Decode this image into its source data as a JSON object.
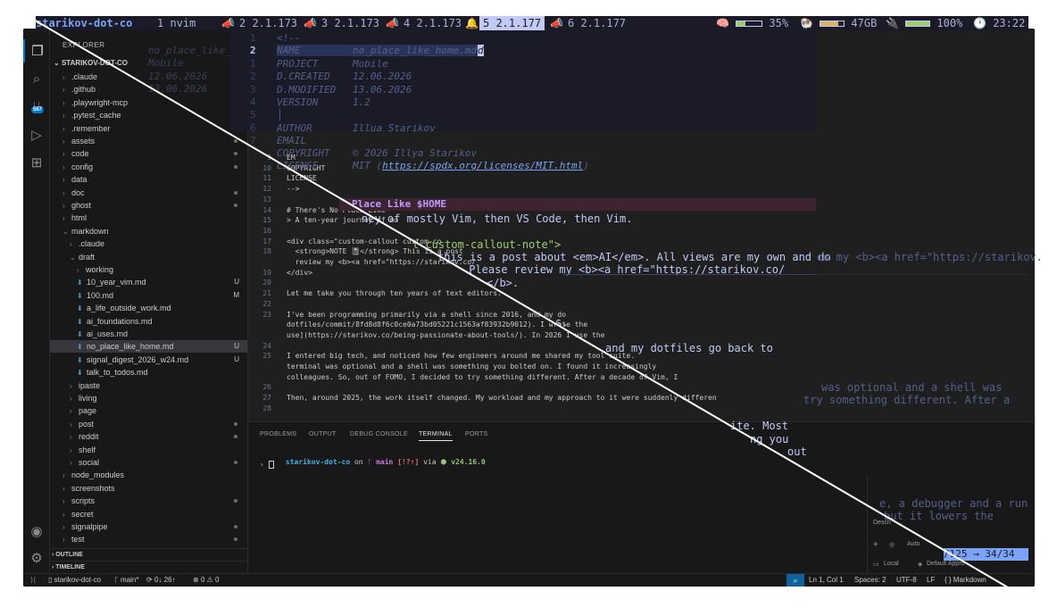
{
  "tmux": {
    "session": "starikov-dot-co",
    "windows": [
      {
        "label": "1 nvim",
        "icon": "",
        "selected": false
      },
      {
        "label": "2 2.1.173",
        "icon": "📣",
        "selected": false
      },
      {
        "label": "3 2.1.173",
        "icon": "📣",
        "selected": false
      },
      {
        "label": "4 2.1.173",
        "icon": "📣",
        "selected": false
      },
      {
        "label": "5 2.1.177",
        "icon": "🔔",
        "selected": true
      },
      {
        "label": "6 2.1.177",
        "icon": "📣",
        "selected": false
      }
    ],
    "cpu": "35%",
    "memory": "47GB",
    "battery": "100%",
    "clock": "23:22",
    "cpu_level": 0.35,
    "memory_level": 0.75,
    "battery_level": 1.0,
    "colors": {
      "session": "#7aa2f7",
      "selected_window": "#c0caf5",
      "battery": "#9ece6a"
    }
  },
  "nvim": {
    "header_lines": [
      {
        "num": "1",
        "label": "<!--",
        "value": ""
      },
      {
        "num": "2",
        "label": "NAME",
        "value": "no_place_like_home.md"
      },
      {
        "num": "1",
        "label": "PROJECT",
        "value": "Mobile"
      },
      {
        "num": "2",
        "label": "D.CREATED",
        "value": "12.06.2026"
      },
      {
        "num": "3",
        "label": "D.MODIFIED",
        "value": "13.06.2026"
      },
      {
        "num": "4",
        "label": "VERSION",
        "value": "1.2"
      },
      {
        "num": "5",
        "label": "",
        "value": ""
      },
      {
        "num": "6",
        "label": "AUTHOR",
        "value": "Illua Starikov"
      },
      {
        "num": "7",
        "label": "EMAIL",
        "value": ""
      }
    ],
    "overlay_lines": [
      {
        "label": "COPYRIGHT",
        "value": "© 2026 Illya Starikov"
      },
      {
        "label": "LICENSE",
        "value": "MIT (https://spdx.org/licenses/MIT.html)"
      }
    ],
    "ghost_left": [
      "no_place_like_",
      "Mobile",
      "12.06.2026",
      "13.06.2026"
    ],
    "heading": "Place Like $HOME",
    "line_ney": "ney of mostly Vim, then VS Code, then Vim.",
    "line_callout": "t custom-callout-note\">",
    "line_post": "this is a post about <em>AI</em>. All views are my own and do",
    "line_review": " Please review my <b><a href=\"https://starikov.co/",
    "line_b": "</b>.",
    "line_right_review": "ew my <b><a href=\"https://starikov.",
    "line_s": "s.",
    "line_dotfiles": "and my dotfiles go back to",
    "line_optional": "was optional and a shell was",
    "line_try": "try something different. After a",
    "line_ite": "ite. Most",
    "line_ng": "ng you",
    "line_out": "out",
    "line_debugger": "e, a debugger and a run",
    "line_lowers": "but it lowers the",
    "status": "/125 → 34/34"
  },
  "vscode": {
    "activity": [
      "files-icon",
      "search-icon",
      "source-control-icon",
      "run-debug-icon",
      "extensions-icon"
    ],
    "scm_badge": "567",
    "explorer_title": "EXPLORER",
    "repo": "STARIKOV-DOT-CO",
    "tree": [
      {
        "label": ".claude",
        "indent": 1,
        "type": "folder",
        "status": ""
      },
      {
        "label": ".github",
        "indent": 1,
        "type": "folder",
        "status": ""
      },
      {
        "label": ".playwright-mcp",
        "indent": 1,
        "type": "folder",
        "status": ""
      },
      {
        "label": ".pytest_cache",
        "indent": 1,
        "type": "folder",
        "status": ""
      },
      {
        "label": ".remember",
        "indent": 1,
        "type": "folder",
        "status": ""
      },
      {
        "label": "assets",
        "indent": 1,
        "type": "folder",
        "status": "dot"
      },
      {
        "label": "code",
        "indent": 1,
        "type": "folder",
        "status": "dot"
      },
      {
        "label": "config",
        "indent": 1,
        "type": "folder",
        "status": "dot"
      },
      {
        "label": "data",
        "indent": 1,
        "type": "folder",
        "status": ""
      },
      {
        "label": "doc",
        "indent": 1,
        "type": "folder",
        "status": "dot"
      },
      {
        "label": "ghost",
        "indent": 1,
        "type": "folder",
        "status": "dot"
      },
      {
        "label": "html",
        "indent": 1,
        "type": "folder",
        "status": ""
      },
      {
        "label": "markdown",
        "indent": 1,
        "type": "folder-open",
        "status": ""
      },
      {
        "label": ".claude",
        "indent": 2,
        "type": "folder",
        "status": ""
      },
      {
        "label": "draft",
        "indent": 2,
        "type": "folder-open",
        "status": ""
      },
      {
        "label": "working",
        "indent": 3,
        "type": "folder",
        "status": ""
      },
      {
        "label": "10_year_vim.md",
        "indent": 3,
        "type": "file",
        "status": "U"
      },
      {
        "label": "100.md",
        "indent": 3,
        "type": "file",
        "status": "M"
      },
      {
        "label": "a_life_outside_work.md",
        "indent": 3,
        "type": "file",
        "status": ""
      },
      {
        "label": "ai_foundations.md",
        "indent": 3,
        "type": "file",
        "status": ""
      },
      {
        "label": "ai_uses.md",
        "indent": 3,
        "type": "file",
        "status": ""
      },
      {
        "label": "no_place_like_home.md",
        "indent": 3,
        "type": "file",
        "status": "U",
        "selected": true
      },
      {
        "label": "signal_digest_2026_w24.md",
        "indent": 3,
        "type": "file",
        "status": "U"
      },
      {
        "label": "talk_to_todos.md",
        "indent": 3,
        "type": "file",
        "status": ""
      },
      {
        "label": "ipaste",
        "indent": 2,
        "type": "folder",
        "status": ""
      },
      {
        "label": "living",
        "indent": 2,
        "type": "folder",
        "status": ""
      },
      {
        "label": "page",
        "indent": 2,
        "type": "folder",
        "status": ""
      },
      {
        "label": "post",
        "indent": 2,
        "type": "folder",
        "status": "dot"
      },
      {
        "label": "reddit",
        "indent": 2,
        "type": "folder",
        "status": "dot"
      },
      {
        "label": "shelf",
        "indent": 2,
        "type": "folder",
        "status": ""
      },
      {
        "label": "social",
        "indent": 2,
        "type": "folder",
        "status": "dot"
      },
      {
        "label": "node_modules",
        "indent": 1,
        "type": "folder",
        "status": ""
      },
      {
        "label": "screenshots",
        "indent": 1,
        "type": "folder",
        "status": ""
      },
      {
        "label": "scripts",
        "indent": 1,
        "type": "folder",
        "status": "dot"
      },
      {
        "label": "secret",
        "indent": 1,
        "type": "folder",
        "status": ""
      },
      {
        "label": "signalpipe",
        "indent": 1,
        "type": "folder",
        "status": "dot"
      },
      {
        "label": "test",
        "indent": 1,
        "type": "folder",
        "status": "dot"
      }
    ],
    "sections": [
      "OUTLINE",
      "TIMELINE"
    ],
    "editor_lines": [
      {
        "num": "9",
        "text": "EM"
      },
      {
        "num": "10",
        "text": "COPYRIGHT"
      },
      {
        "num": "11",
        "text": "LICENSE"
      },
      {
        "num": "12",
        "text": "-->"
      },
      {
        "num": "13",
        "text": ""
      },
      {
        "num": "14",
        "text": "# There's No Place Like"
      },
      {
        "num": "15",
        "text": "> A ten-year journey of mo"
      },
      {
        "num": "16",
        "text": ""
      },
      {
        "num": "17",
        "text": "<div class=\"custom-callout custom-co"
      },
      {
        "num": "18",
        "text": "  <strong>NOTE 📓</strong> This is a post"
      },
      {
        "num": "",
        "text": "  review my <b><a href=\"https://starikov.co/"
      },
      {
        "num": "19",
        "text": "</div>"
      },
      {
        "num": "20",
        "text": ""
      },
      {
        "num": "21",
        "text": "Let me take you through ten years of text editors."
      },
      {
        "num": "22",
        "text": ""
      },
      {
        "num": "23",
        "text": "I've been programming primarily via a shell since 2016, and my do"
      },
      {
        "num": "",
        "text": "dotfiles/commit/8fd8d8f6c0ce0a73bd05221c1563af83932b9012). I wrote the"
      },
      {
        "num": "",
        "text": "use](https://starikov.co/being-passionate-about-tools/). In 2026 I use the"
      },
      {
        "num": "24",
        "text": ""
      },
      {
        "num": "25",
        "text": "I entered big tech, and noticed how few engineers around me shared my tool suite."
      },
      {
        "num": "",
        "text": "terminal was optional and a shell was something you bolted on. I found it increasingly"
      },
      {
        "num": "",
        "text": "colleagues. So, out of FOMO, I decided to try something different. After a decade of Vim, I"
      },
      {
        "num": "26",
        "text": ""
      },
      {
        "num": "27",
        "text": "Then, around 2025, the work itself changed. My workload and my approach to it were suddenly differen"
      },
      {
        "num": "28",
        "text": ""
      }
    ],
    "panel_tabs": [
      "PROBLEMS",
      "OUTPUT",
      "DEBUG CONSOLE",
      "TERMINAL",
      "PORTS"
    ],
    "active_panel_tab": "TERMINAL",
    "terminal": {
      "cwd": "starikov-dot-co",
      "on": "on",
      "branch": "main",
      "git_status": "[!?⇡]",
      "via": "via",
      "node": "v24.16.0",
      "prompt": "›"
    },
    "chat": {
      "describe": "Descri",
      "auto": "Auto",
      "local": "Local",
      "approvals": "Default Appro"
    },
    "statusbar": {
      "repo": "starikov-dot-co",
      "branch": "main*",
      "sync": "0↓ 26↑",
      "errors": "0",
      "warnings": "0",
      "position": "Ln 1, Col 1",
      "spaces": "Spaces: 2",
      "encoding": "UTF-8",
      "eol": "LF",
      "language": "Markdown"
    }
  }
}
